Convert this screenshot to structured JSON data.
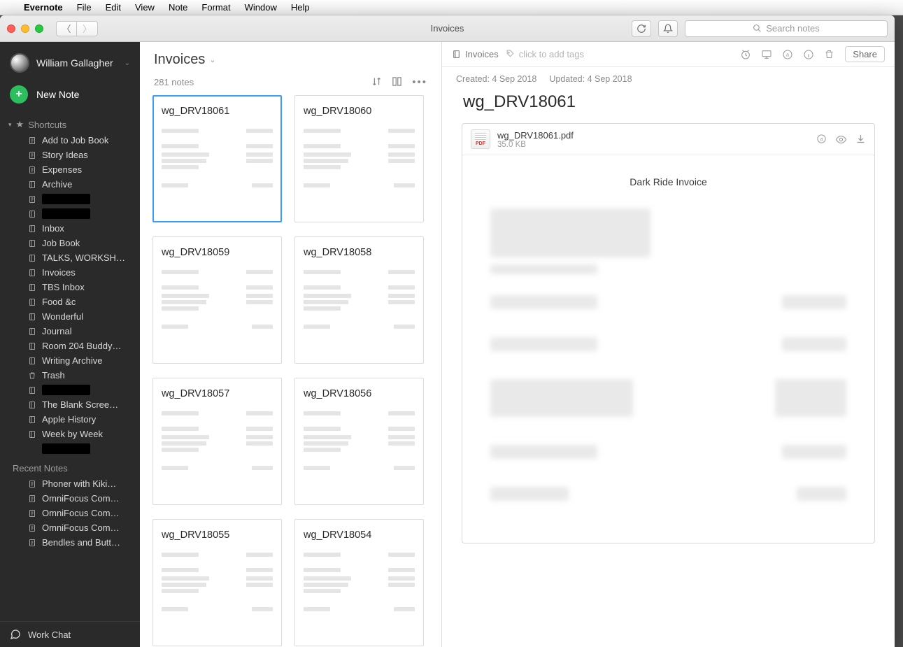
{
  "menubar": {
    "apple": "",
    "items": [
      "Evernote",
      "File",
      "Edit",
      "View",
      "Note",
      "Format",
      "Window",
      "Help"
    ]
  },
  "window": {
    "title": "Invoices"
  },
  "search": {
    "placeholder": "Search notes"
  },
  "user": {
    "name": "William Gallagher"
  },
  "newnote": {
    "label": "New Note"
  },
  "sidebar": {
    "shortcuts_label": "Shortcuts",
    "shortcuts": [
      {
        "label": "Add to Job Book",
        "icon": "note"
      },
      {
        "label": "Story Ideas",
        "icon": "note"
      },
      {
        "label": "Expenses",
        "icon": "note"
      },
      {
        "label": "Archive",
        "icon": "notebook"
      },
      {
        "label": "",
        "icon": "note",
        "redacted": true
      },
      {
        "label": "",
        "icon": "notebook",
        "redacted": true
      },
      {
        "label": "Inbox",
        "icon": "notebook"
      },
      {
        "label": "Job Book",
        "icon": "notebook"
      },
      {
        "label": "TALKS, WORKSH…",
        "icon": "notebook"
      },
      {
        "label": "Invoices",
        "icon": "notebook"
      },
      {
        "label": "TBS Inbox",
        "icon": "notebook"
      },
      {
        "label": "Food &c",
        "icon": "notebook"
      },
      {
        "label": "Wonderful",
        "icon": "notebook"
      },
      {
        "label": "Journal",
        "icon": "notebook"
      },
      {
        "label": "Room 204 Buddy…",
        "icon": "notebook"
      },
      {
        "label": "Writing Archive",
        "icon": "notebook"
      },
      {
        "label": "Trash",
        "icon": "trash"
      },
      {
        "label": "",
        "icon": "notebook",
        "redacted": true
      },
      {
        "label": "The Blank Scree…",
        "icon": "notebook"
      },
      {
        "label": "Apple History",
        "icon": "notebook"
      },
      {
        "label": "Week by Week",
        "icon": "notebook"
      },
      {
        "label": "",
        "icon": "",
        "redacted": true
      }
    ],
    "recent_label": "Recent Notes",
    "recent": [
      {
        "label": "Phoner with Kiki…"
      },
      {
        "label": "OmniFocus Com…"
      },
      {
        "label": "OmniFocus Com…"
      },
      {
        "label": "OmniFocus Com…"
      },
      {
        "label": "Bendles and Butt…"
      }
    ],
    "workchat": "Work Chat"
  },
  "notelist": {
    "title": "Invoices",
    "count": "281 notes",
    "cards": [
      {
        "title": "wg_DRV18061",
        "selected": true
      },
      {
        "title": "wg_DRV18060"
      },
      {
        "title": "wg_DRV18059"
      },
      {
        "title": "wg_DRV18058"
      },
      {
        "title": "wg_DRV18057"
      },
      {
        "title": "wg_DRV18056"
      },
      {
        "title": "wg_DRV18055"
      },
      {
        "title": "wg_DRV18054"
      }
    ]
  },
  "detail": {
    "notebook": "Invoices",
    "tagprompt": "click to add tags",
    "created": "Created: 4 Sep 2018",
    "updated": "Updated: 4 Sep 2018",
    "title": "wg_DRV18061",
    "share": "Share",
    "pdf": {
      "name": "wg_DRV18061.pdf",
      "size": "35.0 KB",
      "badge": "PDF",
      "heading": "Dark Ride Invoice"
    }
  }
}
